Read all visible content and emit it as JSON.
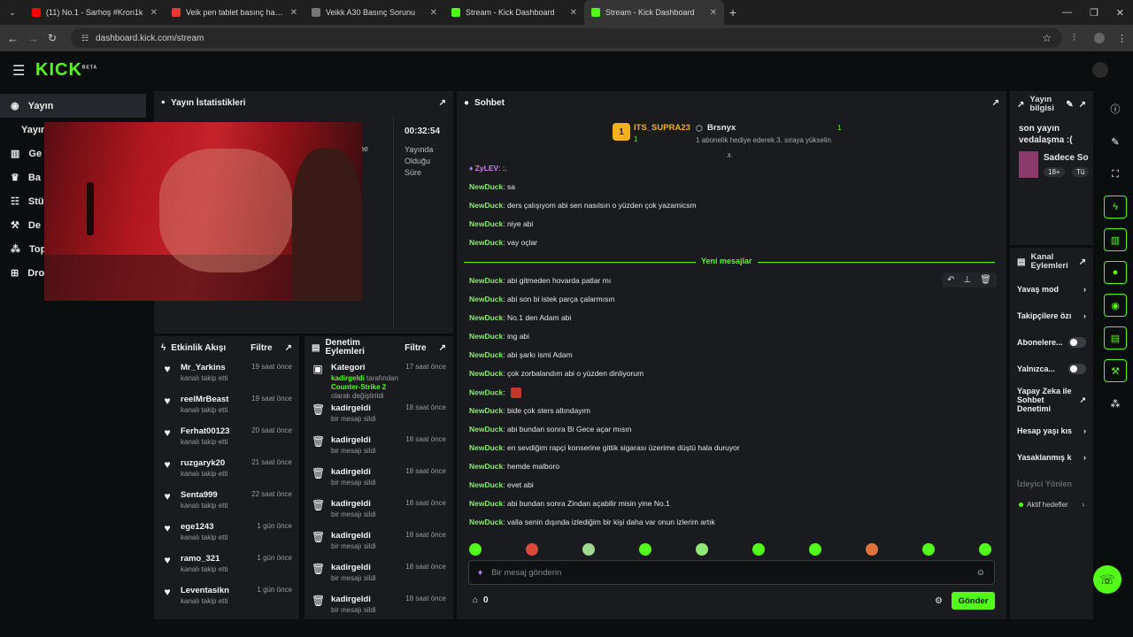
{
  "browser": {
    "tabs": [
      {
        "title": "(11) No.1 - Sarhoş #Kron1k",
        "fav": "#ff0000",
        "active": false
      },
      {
        "title": "Veik pen tablet basınç hassasiye",
        "fav": "#e53935",
        "active": false
      },
      {
        "title": "Veikk A30 Basınç Sorunu",
        "fav": "#777777",
        "active": false
      },
      {
        "title": "Stream - Kick Dashboard",
        "fav": "#53fc18",
        "active": false
      },
      {
        "title": "Stream - Kick Dashboard",
        "fav": "#53fc18",
        "active": true
      }
    ],
    "url": "dashboard.kick.com/stream"
  },
  "brand": {
    "logo": "KICK",
    "beta": "BETA",
    "accent": "#53fc18"
  },
  "sidebar": {
    "items": [
      {
        "label": "Yayın",
        "icon": "broadcast-icon",
        "active": true
      },
      {
        "label": "Yayın",
        "icon": "",
        "active": false
      },
      {
        "label": "Ge",
        "icon": "chart-icon",
        "active": false
      },
      {
        "label": "Ba",
        "icon": "trophy-icon",
        "active": false
      },
      {
        "label": "Stü",
        "icon": "studio-icon",
        "active": false
      },
      {
        "label": "De",
        "icon": "wrench-icon",
        "active": false
      },
      {
        "label": "Top",
        "icon": "community-icon",
        "active": false
      },
      {
        "label": "Dro",
        "icon": "drops-icon",
        "active": false
      }
    ]
  },
  "stats": {
    "title": "Yayın İstatistikleri",
    "time": "00:32:54",
    "time_label": "Yayında Olduğu Süre",
    "partial": "ne"
  },
  "feed": {
    "title": "Etkinlik Akışı",
    "filter": "Filtre",
    "rows": [
      {
        "name": "Mr_Yarkins",
        "sub": "kanalı takip etti",
        "time": "19 saat önce"
      },
      {
        "name": "reelMrBeast",
        "sub": "kanalı takip etti",
        "time": "19 saat önce"
      },
      {
        "name": "Ferhat00123",
        "sub": "kanalı takip etti",
        "time": "20 saat önce"
      },
      {
        "name": "ruzgaryk20",
        "sub": "kanalı takip etti",
        "time": "21 saat önce"
      },
      {
        "name": "Senta999",
        "sub": "kanalı takip etti",
        "time": "22 saat önce"
      },
      {
        "name": "ege1243",
        "sub": "kanalı takip etti",
        "time": "1 gün önce"
      },
      {
        "name": "ramo_321",
        "sub": "kanalı takip etti",
        "time": "1 gün önce"
      },
      {
        "name": "Leventasikn",
        "sub": "kanalı takip etti",
        "time": "1 gün önce"
      }
    ]
  },
  "moderation": {
    "title": "Denetim Eylemleri",
    "filter": "Filtre",
    "first": {
      "name": "Kategori",
      "actor": "kadirgeldi",
      "text": " tarafından ",
      "cat": "Counter-Strike 2",
      "tail": " olarak değiştirildi",
      "time": "17 saat önce"
    },
    "rows": [
      {
        "name": "kadirgeldi",
        "sub": "bir mesajı sildi",
        "time": "18 saat önce"
      },
      {
        "name": "kadirgeldi",
        "sub": "bir mesajı sildi",
        "time": "18 saat önce"
      },
      {
        "name": "kadirgeldi",
        "sub": "bir mesajı sildi",
        "time": "18 saat önce"
      },
      {
        "name": "kadirgeldi",
        "sub": "bir mesajı sildi",
        "time": "18 saat önce"
      },
      {
        "name": "kadirgeldi",
        "sub": "bir mesajı sildi",
        "time": "18 saat önce"
      },
      {
        "name": "kadirgeldi",
        "sub": "bir mesajı sildi",
        "time": "18 saat önce"
      },
      {
        "name": "kadirgeldi",
        "sub": "bir mesajı sildi",
        "time": "18 saat önce"
      }
    ]
  },
  "chat": {
    "title": "Sohbet",
    "leader": {
      "rank": "1",
      "name": "ITS_SUPRA23",
      "count": "1",
      "name2": "Brsnyx",
      "count2": "1",
      "note": "1 abonelik hediye ederek 3. sıraya yükselin"
    },
    "zy_name": "ZyLEV",
    "zy_text": ":.",
    "before": [
      {
        "u": "NewDuck",
        "t": "sa"
      },
      {
        "u": "NewDuck",
        "t": "ders çalışıyom abi sen nasılsın o yüzden çok yazamicsm"
      },
      {
        "u": "NewDuck",
        "t": "niye abi"
      },
      {
        "u": "NewDuck",
        "t": "vay oçlar"
      }
    ],
    "new_label": "Yeni mesajlar",
    "after": [
      {
        "u": "NewDuck",
        "t": "abi gitmeden hovarda patlar mı"
      },
      {
        "u": "NewDuck",
        "t": "abi son bi istek parça çalarmısın"
      },
      {
        "u": "NewDuck",
        "t": "No.1 den Adam abi"
      },
      {
        "u": "NewDuck",
        "t": "ing abi"
      },
      {
        "u": "NewDuck",
        "t": "abi şarkı ismi Adam"
      },
      {
        "u": "NewDuck",
        "t": "çok zorbalandım abi o yüzden dinliyorum"
      },
      {
        "u": "NewDuck",
        "t": ""
      },
      {
        "u": "NewDuck",
        "t": "bide çok sters altındayım"
      },
      {
        "u": "NewDuck",
        "t": "abi bundan sonra Bi Gece açar mısın"
      },
      {
        "u": "NewDuck",
        "t": "en sevdiğim rapçi konserine gittik sigarası üzerime düştü hala duruyor"
      },
      {
        "u": "NewDuck",
        "t": "hemde malboro"
      },
      {
        "u": "NewDuck",
        "t": "evet abi"
      },
      {
        "u": "NewDuck",
        "t": "abi bundan sonra Zindan açabilir misin yine No.1"
      },
      {
        "u": "NewDuck",
        "t": "valla senin dışında izlediğim bir kişi daha var onun izlerim artık"
      }
    ],
    "placeholder": "Bir mesaj gönderin",
    "points": "0",
    "send": "Gönder"
  },
  "info": {
    "title": "Yayın bilgisi",
    "stream_title": "son yayın vedalaşma :(",
    "category": "Sadece So",
    "tag": "18+",
    "tag2": "Tü"
  },
  "actions": {
    "title": "Kanal Eylemleri",
    "items": [
      {
        "label": "Yavaş mod",
        "type": "arrow"
      },
      {
        "label": "Takipçilere özı",
        "type": "arrow"
      },
      {
        "label": "Abonelere...",
        "type": "toggle"
      },
      {
        "label": "Yalnızca...",
        "type": "toggle"
      },
      {
        "label": "Yapay Zeka ile Sohbet Denetimi",
        "type": "ext"
      },
      {
        "label": "Hesap yaşı kıs",
        "type": "arrow"
      },
      {
        "label": "Yasaklanmış k",
        "type": "arrow"
      },
      {
        "label": "İzleyici Yönlendir",
        "type": "disabled"
      }
    ],
    "active_targets": "Aktif hedefler"
  }
}
